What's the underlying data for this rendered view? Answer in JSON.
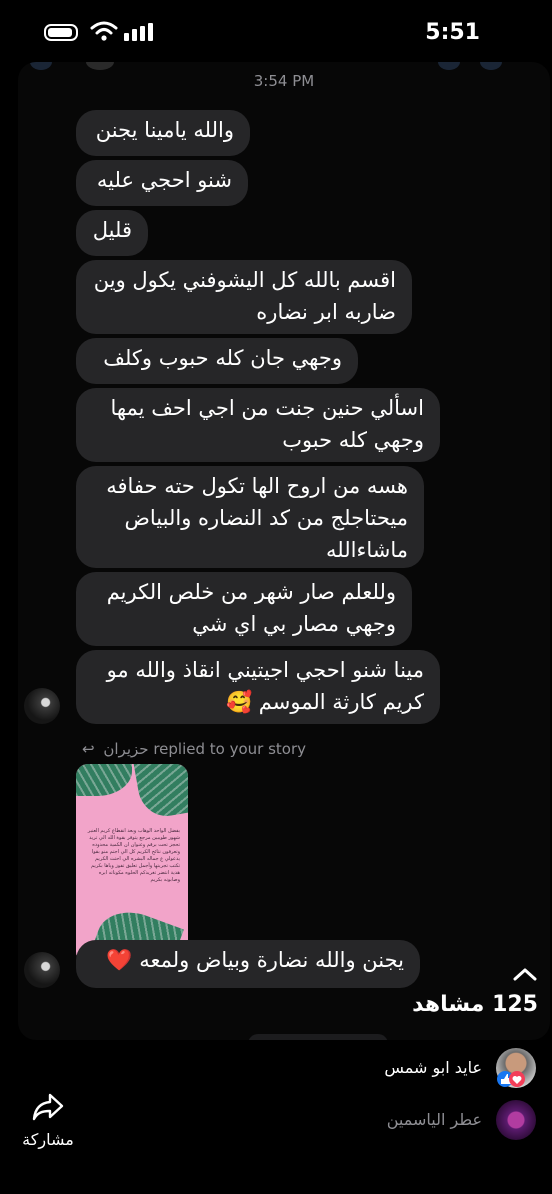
{
  "status_bar": {
    "time": "5:51"
  },
  "chat": {
    "timestamp": "3:54 PM",
    "messages": [
      {
        "lines": [
          "والله يامينا يجنن"
        ]
      },
      {
        "lines": [
          "شنو احجي عليه"
        ]
      },
      {
        "lines": [
          "قليل"
        ]
      },
      {
        "lines": [
          "اقسم بالله كل اليشوفني يكول وين",
          "ضاربه ابر نضاره"
        ]
      },
      {
        "lines": [
          "وجهي جان كله حبوب وكلف"
        ]
      },
      {
        "lines": [
          "اسألي حنين جنت من اجي احف يمها",
          "وجهي كله حبوب"
        ]
      },
      {
        "lines": [
          "هسه من اروح الها تكول حته حفافه",
          "ميحتاجلج من كد النضاره والبياض",
          "ماشاءالله"
        ]
      },
      {
        "lines": [
          "وللعلم صار شهر من خلص الكريم",
          "وجهي مصار بي اي شي"
        ]
      },
      {
        "lines": [
          "مينا شنو احجي اجيتيني انقاذ والله مو",
          "كريم كارثة الموسم 🥰"
        ]
      }
    ],
    "reply": {
      "name": "حزيران",
      "text": "replied to your story"
    },
    "story_text": "بفضل الواحد الوهاب وبعد انقطاع كريم العنبر شهور طويبين مرجع يتوفر بقوة الله الي تريد تحجز تحت برقم وعنوان ان الكمية محدوده وتعرفون نتائج الكريم كل الي اجتم منو بقوا يدعولي ع جماله البشره الي احتث الكريم تكتب تجربتها وأجمل تعليق تفوز وياها بكريم هدية انتضر تغريدكم الحلوه مكوناته ابره وصابونه بكريم",
    "last_message": "يجنن والله نضارة وبياض ولمعه ❤️"
  },
  "views": {
    "label": "125 مشاهد"
  },
  "viewers": [
    {
      "name": "عايد ابو شمس"
    },
    {
      "name": "عطر الياسمين"
    }
  ],
  "share": {
    "label": "مشاركة"
  },
  "colors": {
    "bubble": "#262628",
    "background": "#000000",
    "heart": "#e0245e",
    "muted": "#8e8e93"
  }
}
